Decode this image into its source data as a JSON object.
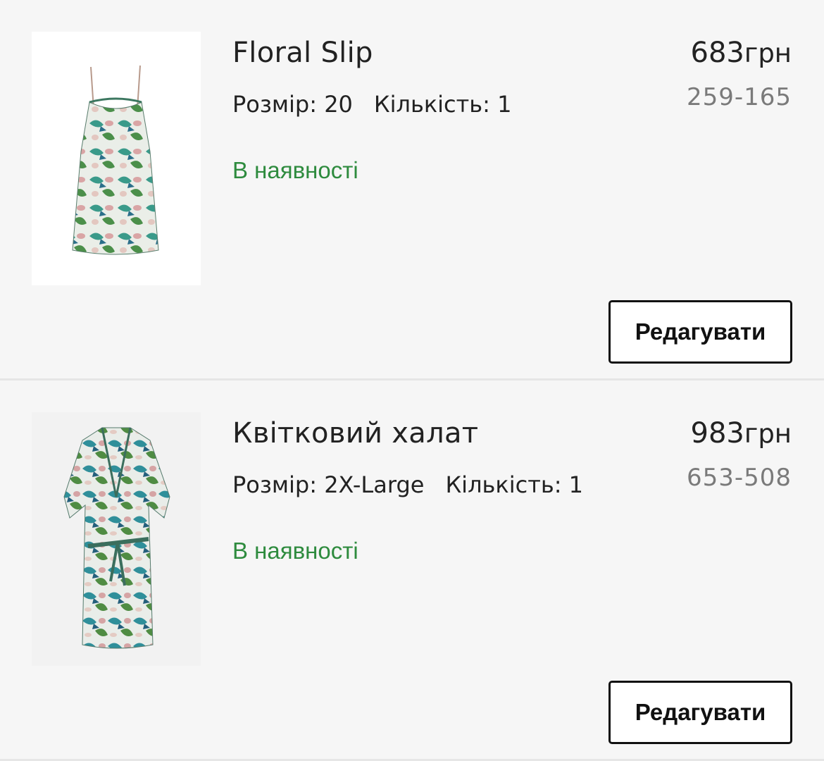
{
  "cart": {
    "items": [
      {
        "name": "Floral Slip",
        "size_label": "Розмір: 20",
        "qty_label": "Кількість: 1",
        "stock": "В наявності",
        "price_amount": "683",
        "price_currency": "грн",
        "sku": "259-165",
        "edit_label": "Редагувати",
        "image_icon": "slip-dress-image"
      },
      {
        "name": "Квітковий халат",
        "size_label": "Розмір: 2X-Large",
        "qty_label": "Кількість: 1",
        "stock": "В наявності",
        "price_amount": "983",
        "price_currency": "грн",
        "sku": "653-508",
        "edit_label": "Редагувати",
        "image_icon": "robe-image"
      }
    ]
  },
  "colors": {
    "in_stock": "#2e8b3e",
    "sku": "#7a7a7a",
    "background": "#f6f6f6"
  }
}
